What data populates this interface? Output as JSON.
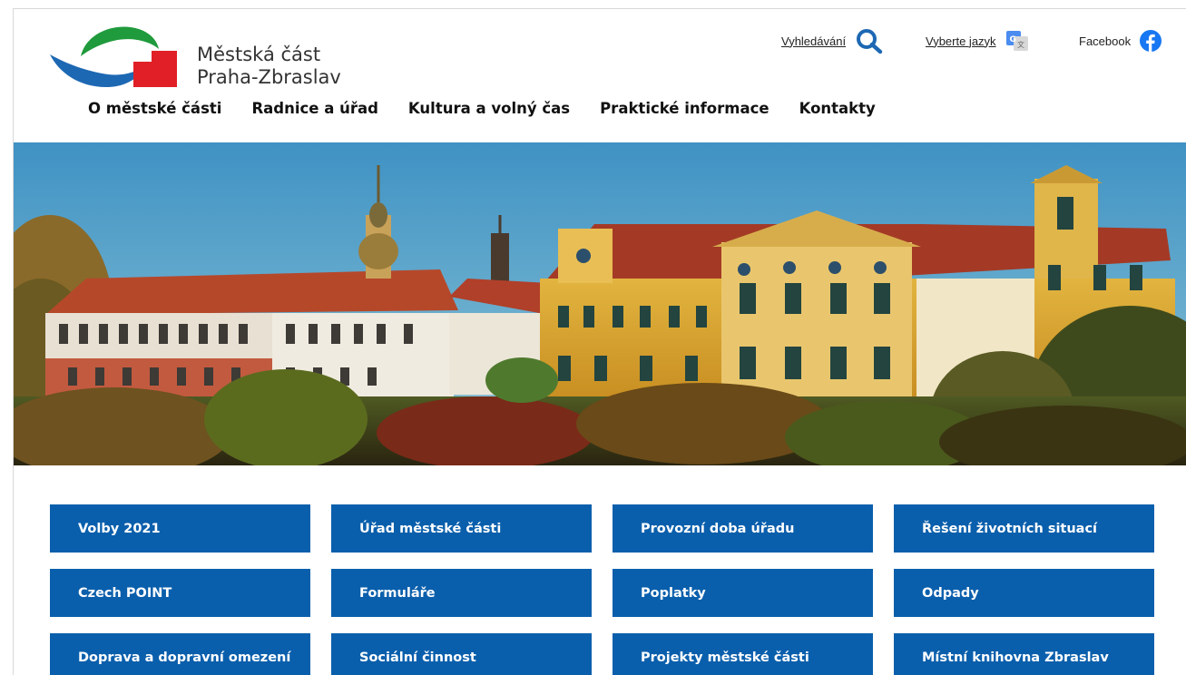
{
  "site": {
    "name_line1": "Městská část",
    "name_line2": "Praha-Zbraslav"
  },
  "tools": {
    "search_label": "Vyhledávání",
    "search_icon": "search-icon",
    "language_label": "Vyberte jazyk",
    "language_icon": "google-translate-icon",
    "facebook_label": "Facebook",
    "facebook_icon": "facebook-icon"
  },
  "nav": {
    "items": [
      "O městské části",
      "Radnice a úřad",
      "Kultura a volný čas",
      "Praktické informace",
      "Kontakty"
    ]
  },
  "hero": {
    "image": "zbraslav-chateau-photo"
  },
  "tiles": {
    "items": [
      "Volby 2021",
      "Úřad městské části",
      "Provozní doba úřadu",
      "Řešení životních situací",
      "Czech POINT",
      "Formuláře",
      "Poplatky",
      "Odpady",
      "Doprava a dopravní omezení",
      "Sociální činnost",
      "Projekty městské části",
      "Místní knihovna Zbraslav"
    ]
  },
  "colors": {
    "brand_blue": "#0a5fac",
    "logo_green": "#1f9a3c",
    "logo_blue": "#1d68b3",
    "logo_red": "#e11f26",
    "facebook_blue": "#1877f2"
  }
}
